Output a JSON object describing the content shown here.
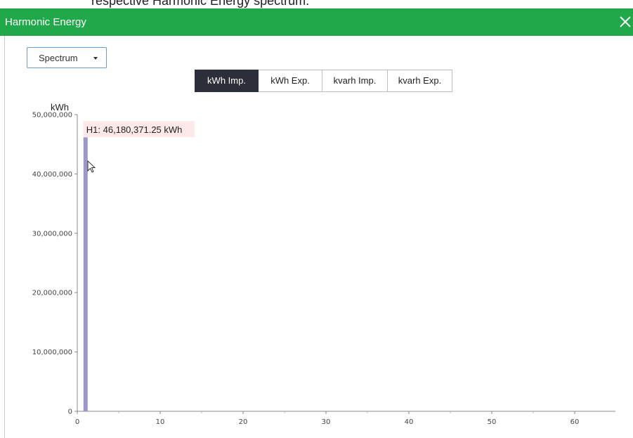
{
  "page_top_text": "respective Harmonic Energy spectrum.",
  "dialog": {
    "title": "Harmonic Energy",
    "close_icon": "close-icon"
  },
  "view_select": {
    "selected": "Spectrum",
    "caret_icon": "caret-down-icon"
  },
  "tabs": [
    {
      "label": "kWh Imp.",
      "active": true
    },
    {
      "label": "kWh Exp.",
      "active": false
    },
    {
      "label": "kvarh Imp.",
      "active": false
    },
    {
      "label": "kvarh Exp.",
      "active": false
    }
  ],
  "colors": {
    "titlebar": "#21a84a",
    "active_tab": "#2c2f3a",
    "bar": "#9b97c8",
    "tooltip_bg": "#fde9e7"
  },
  "chart_data": {
    "type": "bar",
    "ylabel": "kWh",
    "ylim": [
      0,
      50000000
    ],
    "y_ticks": [
      "0",
      "10,000,000",
      "20,000,000",
      "30,000,000",
      "40,000,000",
      "50,000,000"
    ],
    "y_tick_values": [
      0,
      10000000,
      20000000,
      30000000,
      40000000,
      50000000
    ],
    "xlim": [
      0,
      65
    ],
    "x_ticks": [
      "0",
      "10",
      "20",
      "30",
      "40",
      "50",
      "60"
    ],
    "x_tick_values": [
      0,
      10,
      20,
      30,
      40,
      50,
      60
    ],
    "bars": [
      {
        "x": 1,
        "value": 46180371.25
      }
    ],
    "tooltip": "H1: 46,180,371.25 kWh"
  }
}
